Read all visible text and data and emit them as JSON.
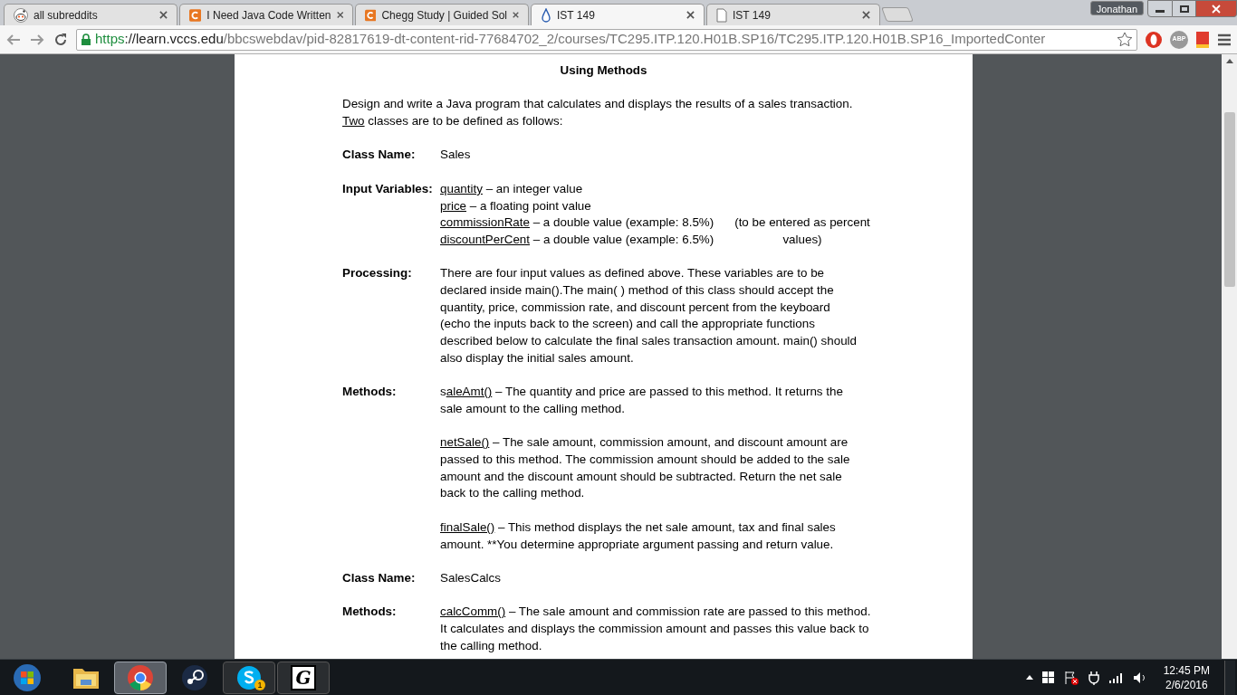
{
  "browser": {
    "tabs": [
      {
        "title": "all subreddits",
        "kind": "alien",
        "selected": false
      },
      {
        "title": "I Need Java Code Written",
        "kind": "c",
        "selected": false
      },
      {
        "title": "Chegg Study | Guided Sol",
        "kind": "c",
        "selected": false
      },
      {
        "title": "IST 149",
        "kind": "drop",
        "selected": true
      },
      {
        "title": "IST 149",
        "kind": "page",
        "selected": false
      }
    ],
    "user": "Jonathan",
    "url": {
      "scheme": "https",
      "host": "://learn.vccs.edu",
      "path": "/bbcswebdav/pid-82817619-dt-content-rid-77684702_2/courses/TC295.ITP.120.H01B.SP16/TC295.ITP.120.H01B.SP16_ImportedConter"
    },
    "extensions": [
      {
        "kind": "opera"
      },
      {
        "kind": "abp",
        "label": "ABP"
      },
      {
        "kind": "bookmark"
      }
    ]
  },
  "document": {
    "heading": [
      "Using Methods"
    ],
    "intro": [
      [
        {
          "text": "Design and write a Java program that calculates and displays the results of a sales transaction.",
          "underline": false
        }
      ],
      [
        {
          "text": "Two",
          "underline": true
        },
        {
          "text": " classes are to be defined as follows:",
          "underline": false
        }
      ]
    ],
    "sections": [
      {
        "label": "Class Name:",
        "kind": "text",
        "paragraphs": [
          [
            [
              {
                "text": "Sales",
                "underline": false
              }
            ]
          ]
        ]
      },
      {
        "label": "Input Variables:",
        "kind": "variables",
        "rows": [
          {
            "line": [
              {
                "text": "quantity",
                "underline": true
              },
              {
                "text": " – an integer value",
                "underline": false
              }
            ]
          },
          {
            "line": [
              {
                "text": "price",
                "underline": true
              },
              {
                "text": " – a floating point value",
                "underline": false
              }
            ]
          },
          {
            "line": [
              {
                "text": "commissionRate",
                "underline": true
              },
              {
                "text": " – a double value (example: 8.5%)",
                "underline": false
              }
            ],
            "note": "(to be entered as percent"
          },
          {
            "line": [
              {
                "text": "discountPerCent",
                "underline": true
              },
              {
                "text": " – a double value (example: 6.5%)",
                "underline": false
              }
            ],
            "note": "values)"
          }
        ]
      },
      {
        "label": "Processing:",
        "kind": "text",
        "paragraphs": [
          [
            [
              {
                "text": "There are four input values as defined above. These variables are to be",
                "underline": false
              }
            ],
            [
              {
                "text": "declared inside main().The main( ) method of this class should accept the",
                "underline": false
              }
            ],
            [
              {
                "text": "quantity, price, commission rate, and discount percent from the keyboard",
                "underline": false
              }
            ],
            [
              {
                "text": "(echo the inputs back to the screen) and call the appropriate functions",
                "underline": false
              }
            ],
            [
              {
                "text": "described below to calculate the final sales transaction amount. main() should",
                "underline": false
              }
            ],
            [
              {
                "text": "also display the initial sales amount.",
                "underline": false
              }
            ]
          ]
        ]
      },
      {
        "label": "Methods:",
        "kind": "text",
        "paragraphs": [
          [
            [
              {
                "text": "s",
                "underline": false
              },
              {
                "text": "aleAmt()",
                "underline": true
              },
              {
                "text": " – The quantity and price are passed to this method. It returns the",
                "underline": false
              }
            ],
            [
              {
                "text": "sale amount to the calling method.",
                "underline": false
              }
            ]
          ],
          [
            [
              {
                "text": "netSale()",
                "underline": true
              },
              {
                "text": " – The sale amount, commission amount, and discount amount are",
                "underline": false
              }
            ],
            [
              {
                "text": "passed to this method. The commission amount should be added to the sale",
                "underline": false
              }
            ],
            [
              {
                "text": "amount and the discount amount should be subtracted. Return the net sale",
                "underline": false
              }
            ],
            [
              {
                "text": "back to the calling method.",
                "underline": false
              }
            ]
          ],
          [
            [
              {
                "text": "finalSale()",
                "underline": true
              },
              {
                "text": " – This method displays the net sale amount, tax and final sales",
                "underline": false
              }
            ],
            [
              {
                "text": "amount.  **You determine appropriate argument passing and return value.",
                "underline": false
              }
            ]
          ]
        ]
      },
      {
        "label": "Class Name:",
        "kind": "text",
        "paragraphs": [
          [
            [
              {
                "text": "SalesCalcs",
                "underline": false
              }
            ]
          ]
        ]
      },
      {
        "label": "Methods:",
        "kind": "text",
        "paragraphs": [
          [
            [
              {
                "text": "calcComm()",
                "underline": true
              },
              {
                "text": " – The sale amount and commission rate are passed to this method.",
                "underline": false
              }
            ],
            [
              {
                "text": "It calculates and displays the commission amount and passes this value back to",
                "underline": false
              }
            ],
            [
              {
                "text": "the calling method.",
                "underline": false
              }
            ]
          ]
        ]
      }
    ]
  },
  "taskbar": {
    "apps": [
      {
        "kind": "explorer",
        "selected": false
      },
      {
        "kind": "chrome",
        "selected": true
      },
      {
        "kind": "steam",
        "selected": false
      },
      {
        "kind": "skype",
        "selected": false,
        "badge": "1"
      },
      {
        "kind": "g",
        "selected": false,
        "label": "G"
      }
    ],
    "time": "12:45 PM",
    "date": "2/6/2016"
  }
}
